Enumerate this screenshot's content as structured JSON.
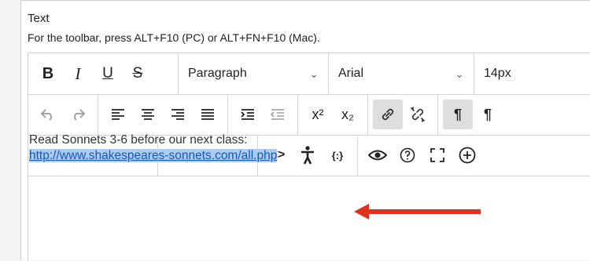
{
  "field": {
    "label": "Text",
    "hint": "For the toolbar, press ALT+F10 (PC) or ALT+FN+F10 (Mac)."
  },
  "toolbar": {
    "format": {
      "bold": "B",
      "italic": "I",
      "underline": "U",
      "strike": "S"
    },
    "block_select": "Paragraph",
    "font_select": "Arial",
    "size_select": "14px",
    "superscript": "x²",
    "subscript": "x₂",
    "ltr": "¶",
    "rtl": "¶"
  },
  "content": {
    "line1": "Read Sonnets 3-6 before our next class:",
    "link": "http://www.shakespeares-sonnets.com/all.php"
  },
  "colors": {
    "arrow": "#e0301e",
    "selection": "#a9cdf4",
    "link": "#1a55b8"
  }
}
